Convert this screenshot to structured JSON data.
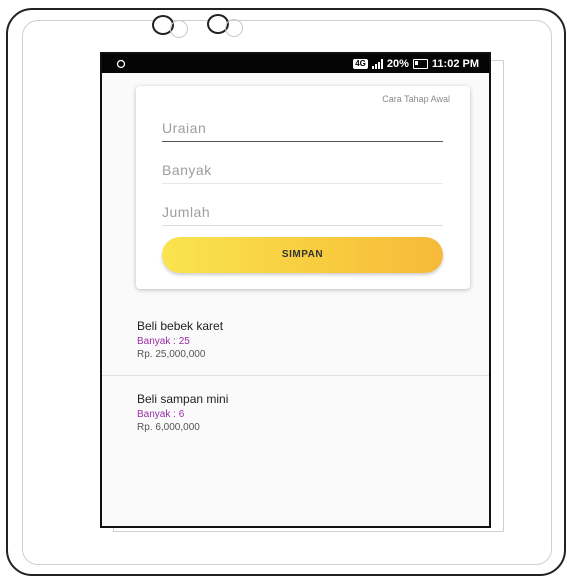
{
  "statusbar": {
    "left_icon": "sync-icon",
    "network": "4G",
    "battery": "20%",
    "time": "11:02 PM"
  },
  "form": {
    "link": "Cara Tahap Awal",
    "fields": {
      "uraian": "Uraian",
      "banyak": "Banyak",
      "jumlah": "Jumlah"
    },
    "button": "SIMPAN",
    "button_gradient": [
      "#f9e44f",
      "#f6b93a"
    ]
  },
  "items": [
    {
      "title": "Beli bebek karet",
      "qty": "Banyak : 25",
      "price": "Rp. 25,000,000"
    },
    {
      "title": "Beli sampan mini",
      "qty": "Banyak : 6",
      "price": "Rp. 6,000,000"
    }
  ],
  "colors": {
    "qty_text": "#9b2fa6",
    "statusbar_bg": "#050505"
  }
}
